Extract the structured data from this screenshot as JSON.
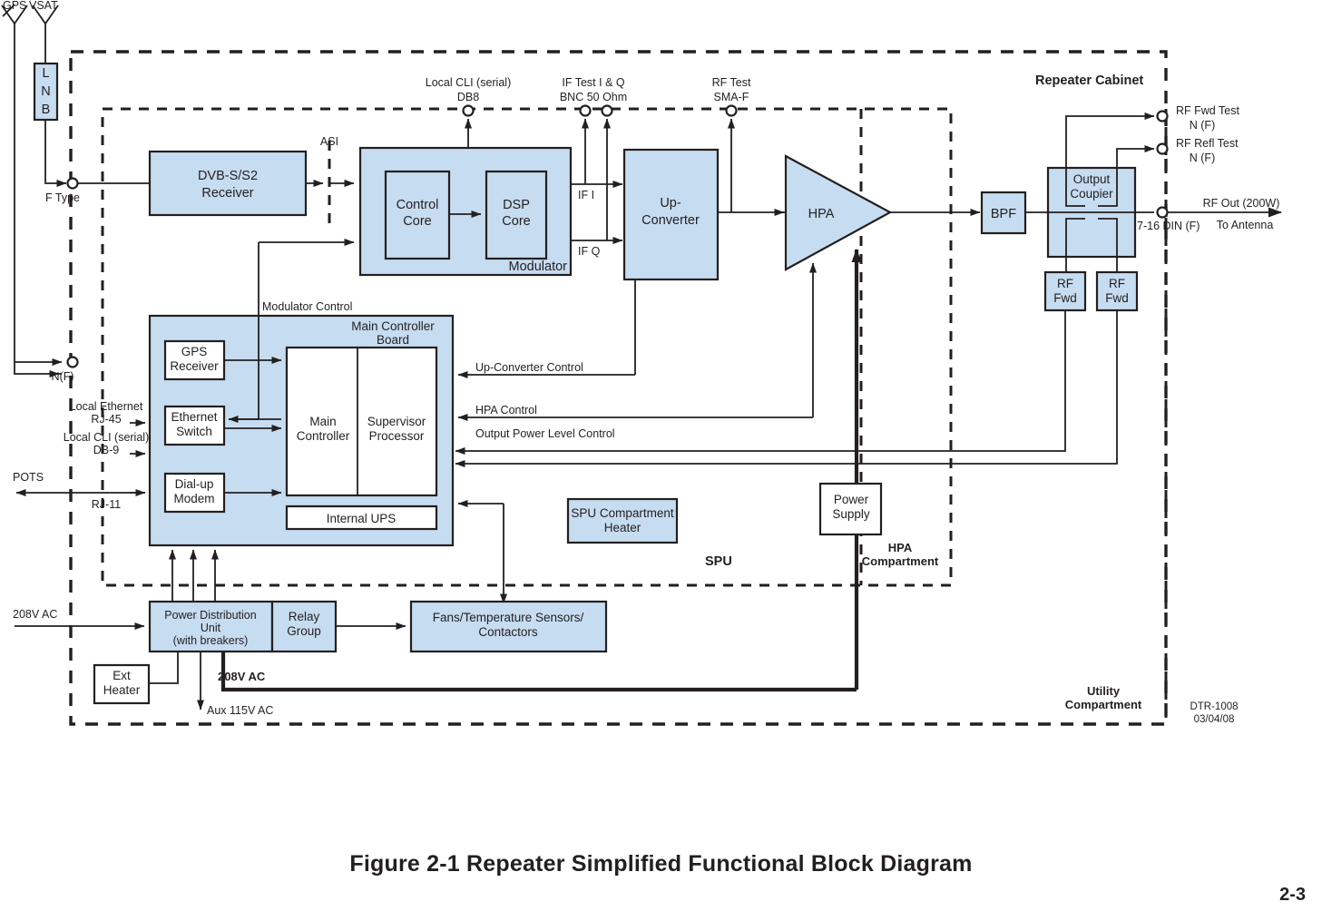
{
  "figure": {
    "caption": "Figure 2-1  Repeater Simplified Functional Block Diagram",
    "page_number": "2-3",
    "drawing_id": "DTR-1008",
    "drawing_date": "03/04/08"
  },
  "colors": {
    "block_fill": "#c6dcf0",
    "line": "#231f20",
    "white_fill": "#ffffff"
  },
  "antennas": [
    {
      "label": "GPS"
    },
    {
      "label": "VSAT"
    }
  ],
  "enclosures": {
    "repeater_cabinet": "Repeater Cabinet",
    "spu": "SPU",
    "hpa_compartment_l1": "HPA",
    "hpa_compartment_l2": "Compartment",
    "utility_compartment_l1": "Utility",
    "utility_compartment_l2": "Compartment"
  },
  "blocks": {
    "lnb": {
      "l1": "L",
      "l2": "N",
      "l3": "B"
    },
    "dvb_receiver": {
      "l1": "DVB-S/S2",
      "l2": "Receiver"
    },
    "modulator": {
      "title": "Modulator"
    },
    "control_core": {
      "l1": "Control",
      "l2": "Core"
    },
    "dsp_core": {
      "l1": "DSP",
      "l2": "Core"
    },
    "up_converter": {
      "l1": "Up-",
      "l2": "Converter"
    },
    "hpa": {
      "label": "HPA"
    },
    "bpf": {
      "label": "BPF"
    },
    "output_coupler": {
      "l1": "Output",
      "l2": "Coupier"
    },
    "rf_fwd_1": {
      "l1": "RF",
      "l2": "Fwd"
    },
    "rf_fwd_2": {
      "l1": "RF",
      "l2": "Fwd"
    },
    "main_controller_board": {
      "l1": "Main Controller",
      "l2": "Board"
    },
    "gps_receiver": {
      "l1": "GPS",
      "l2": "Receiver"
    },
    "ethernet_switch": {
      "l1": "Ethernet",
      "l2": "Switch"
    },
    "dialup_modem": {
      "l1": "Dial-up",
      "l2": "Modem"
    },
    "main_controller": {
      "l1": "Main",
      "l2": "Controller"
    },
    "supervisor_processor": {
      "l1": "Supervisor",
      "l2": "Processor"
    },
    "internal_ups": {
      "label": "Internal UPS"
    },
    "spu_heater": {
      "l1": "SPU Compartment",
      "l2": "Heater"
    },
    "power_supply": {
      "l1": "Power",
      "l2": "Supply"
    },
    "pdu": {
      "l1": "Power Distribution",
      "l2": "Unit",
      "l3": "(with breakers)"
    },
    "relay_group": {
      "l1": "Relay",
      "l2": "Group"
    },
    "fans": {
      "l1": "Fans/Temperature Sensors/",
      "l2": "Contactors"
    },
    "ext_heater": {
      "l1": "Ext",
      "l2": "Heater"
    }
  },
  "connectors": {
    "f_type": "F Type",
    "n_f": "N(F)",
    "local_cli_serial_top_l1": "Local CLI (serial)",
    "local_cli_serial_top_l2": "DB8",
    "if_test_l1": "IF Test I & Q",
    "if_test_l2": "BNC 50 Ohm",
    "rf_test_l1": "RF Test",
    "rf_test_l2": "SMA-F",
    "rf_fwd_test_l1": "RF Fwd Test",
    "rf_fwd_test_l2": "N (F)",
    "rf_refl_test_l1": "RF Refl Test",
    "rf_refl_test_l2": "N (F)",
    "din_7_16": "7-16 DIN (F)",
    "local_ethernet": "Local Ethernet",
    "rj_45": "RJ-45",
    "local_cli_serial_l1": "Local CLI (serial)",
    "db_9": "DB-9",
    "pots": "POTS",
    "rj_11": "RJ-11"
  },
  "signals": {
    "asi": "ASI",
    "if_i": "IF I",
    "if_q": "IF Q",
    "modulator_control": "Modulator Control",
    "up_converter_control": "Up-Converter Control",
    "hpa_control": "HPA Control",
    "output_power_level_control": "Output Power Level Control",
    "rf_out": "RF Out (200W)",
    "to_antenna": "To Antenna"
  },
  "power": {
    "input_208v": "208V AC",
    "bus_208v": "208V AC",
    "aux_115v": "Aux 115V AC"
  }
}
